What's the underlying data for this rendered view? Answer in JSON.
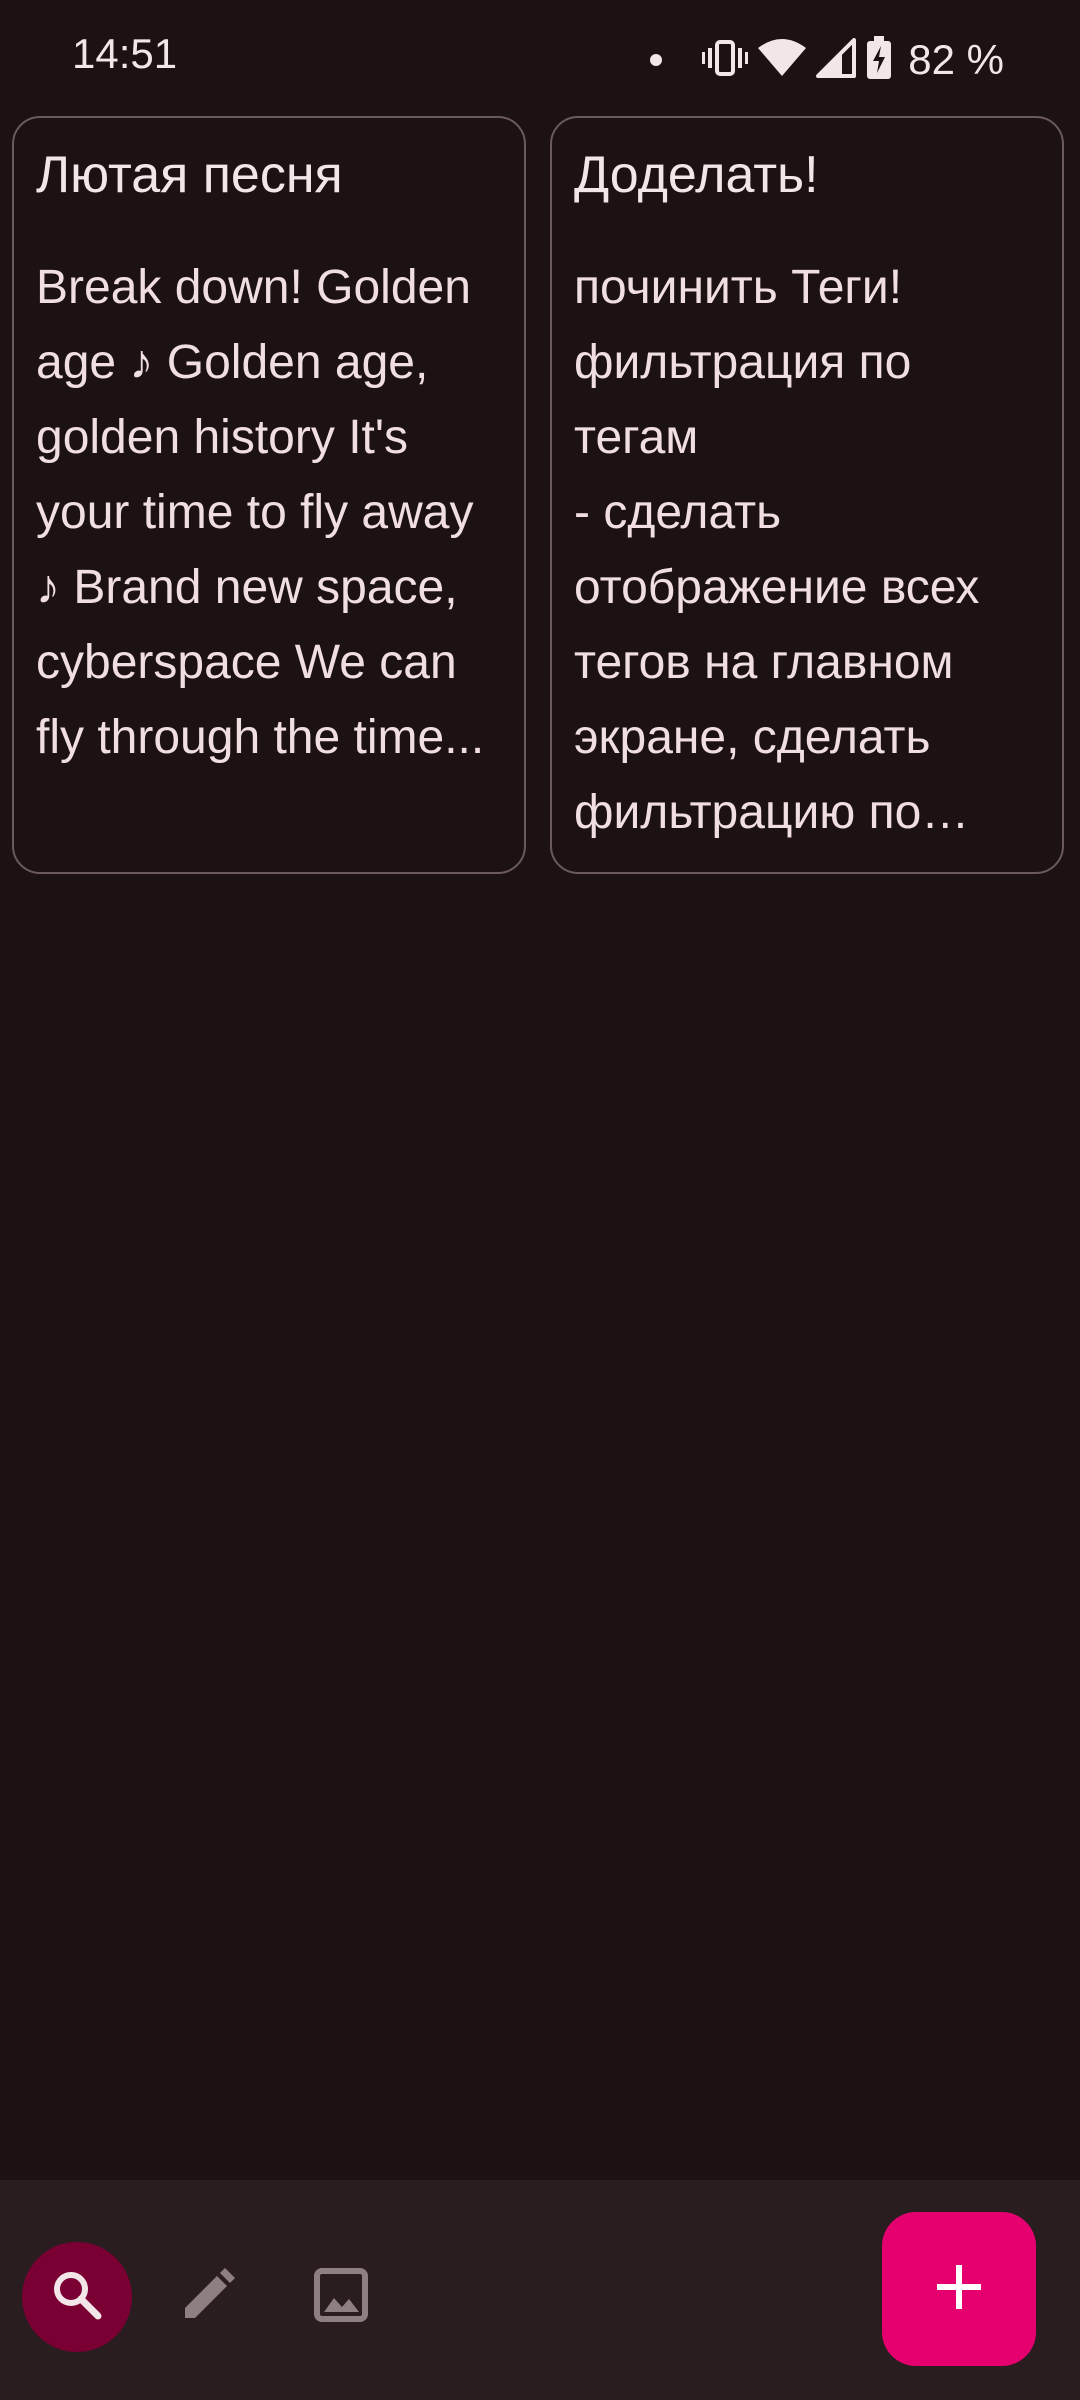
{
  "status_bar": {
    "time": "14:51",
    "battery_text": "82 %",
    "icons": [
      "notification-dot-icon",
      "vibrate-icon",
      "wifi-icon",
      "cell-signal-icon",
      "battery-charging-icon"
    ]
  },
  "notes": [
    {
      "title": "Лютая песня",
      "body": "Break down! Golden age ♪ Golden age, golden history It's your time to fly away ♪ Brand new space, cyberspace We can fly through the time..."
    },
    {
      "title": "Доделать!",
      "body": "починить Теги!\nфильтрация по тегам\n - сделать отображение всех тегов на главном экране, сделать фильтрацию по них..."
    }
  ],
  "bottom_bar": {
    "icons": [
      "search-icon",
      "pencil-icon",
      "image-icon",
      "plus-icon"
    ]
  },
  "colors": {
    "background": "#1c1113",
    "bottom_bar": "#2a1d20",
    "search_active": "#7a0033",
    "fab": "#e6006f",
    "card_border": "#6b5a5d"
  }
}
